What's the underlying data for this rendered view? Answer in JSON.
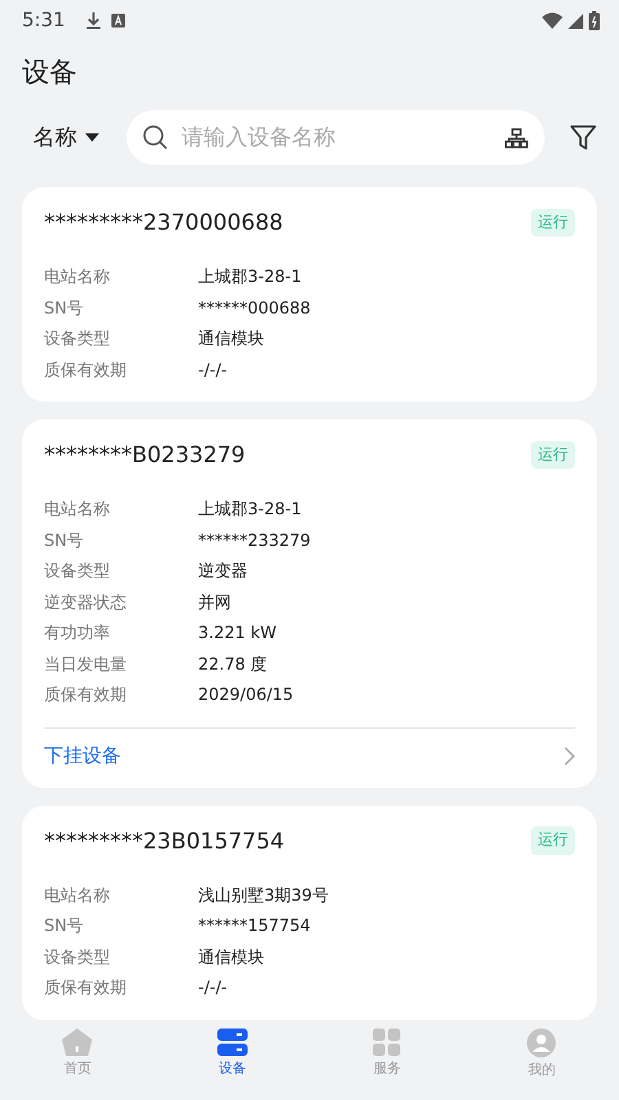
{
  "status_bar": {
    "time": "5:31"
  },
  "title": "设备",
  "filter": {
    "label": "名称"
  },
  "search": {
    "placeholder": "请输入设备名称"
  },
  "devices": [
    {
      "name": "*********2370000688",
      "status": "运行",
      "fields": [
        {
          "label": "电站名称",
          "value": "上城郡3-28-1"
        },
        {
          "label": "SN号",
          "value": "******000688"
        },
        {
          "label": "设备类型",
          "value": "通信模块"
        },
        {
          "label": "质保有效期",
          "value": "-/-/-"
        }
      ]
    },
    {
      "name": "********B0233279",
      "status": "运行",
      "fields": [
        {
          "label": "电站名称",
          "value": "上城郡3-28-1"
        },
        {
          "label": "SN号",
          "value": "******233279"
        },
        {
          "label": "设备类型",
          "value": "逆变器"
        },
        {
          "label": "逆变器状态",
          "value": "并网"
        },
        {
          "label": "有功功率",
          "value": "3.221 kW"
        },
        {
          "label": "当日发电量",
          "value": "22.78 度"
        },
        {
          "label": "质保有效期",
          "value": "2029/06/15"
        }
      ],
      "link": "下挂设备"
    },
    {
      "name": "*********23B0157754",
      "status": "运行",
      "fields": [
        {
          "label": "电站名称",
          "value": "浅山别墅3期39号"
        },
        {
          "label": "SN号",
          "value": "******157754"
        },
        {
          "label": "设备类型",
          "value": "通信模块"
        },
        {
          "label": "质保有效期",
          "value": "-/-/-"
        }
      ]
    }
  ],
  "nav": [
    {
      "kind": "home",
      "label": "首页",
      "selected": false
    },
    {
      "kind": "device",
      "label": "设备",
      "selected": true
    },
    {
      "kind": "service",
      "label": "服务",
      "selected": false
    },
    {
      "kind": "profile",
      "label": "我的",
      "selected": false
    }
  ]
}
